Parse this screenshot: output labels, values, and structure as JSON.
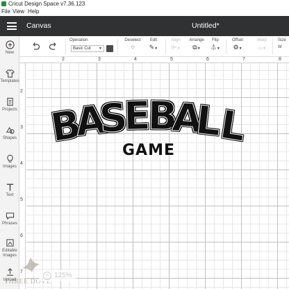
{
  "window": {
    "title": "Cricut Design Space  v7.36.123"
  },
  "menu": {
    "items": [
      "File",
      "View",
      "Help"
    ]
  },
  "header": {
    "section": "Canvas",
    "doc_title": "Untitled*"
  },
  "sidebar": {
    "items": [
      {
        "label": "New",
        "icon": "plus-circle-icon"
      },
      {
        "label": "Templates",
        "icon": "shirt-icon"
      },
      {
        "label": "Projects",
        "icon": "projects-icon"
      },
      {
        "label": "Shapes",
        "icon": "shapes-icon"
      },
      {
        "label": "Images",
        "icon": "lightbulb-icon"
      },
      {
        "label": "Text",
        "icon": "text-icon"
      },
      {
        "label": "Phrases",
        "icon": "speech-bubble-icon"
      },
      {
        "label": "Editable Images",
        "icon": "editable-image-icon"
      },
      {
        "label": "Upload",
        "icon": "upload-icon"
      }
    ]
  },
  "toolbar": {
    "operation_label": "Operation",
    "operation_value": "Basic Cut",
    "operation_swatch": "#4a4a4a",
    "deselect_label": "Deselect",
    "edit_label": "Edit",
    "align_label": "Align",
    "arrange_label": "Arrange",
    "flip_label": "Flip",
    "offset_label": "Offset",
    "warp_label": "Warp",
    "size_label": "Size",
    "size_w": "W"
  },
  "ruler": {
    "top": [
      "2",
      "3",
      "4",
      "5",
      "6",
      "7",
      "8"
    ],
    "left": [
      "2",
      "3",
      "4",
      "5",
      "6",
      "7",
      "8"
    ]
  },
  "design": {
    "headline": "BASEBALL",
    "subtitle": "GAME"
  },
  "zoom": {
    "value": "125%"
  },
  "watermark": {
    "text": "THREE DOVE"
  }
}
